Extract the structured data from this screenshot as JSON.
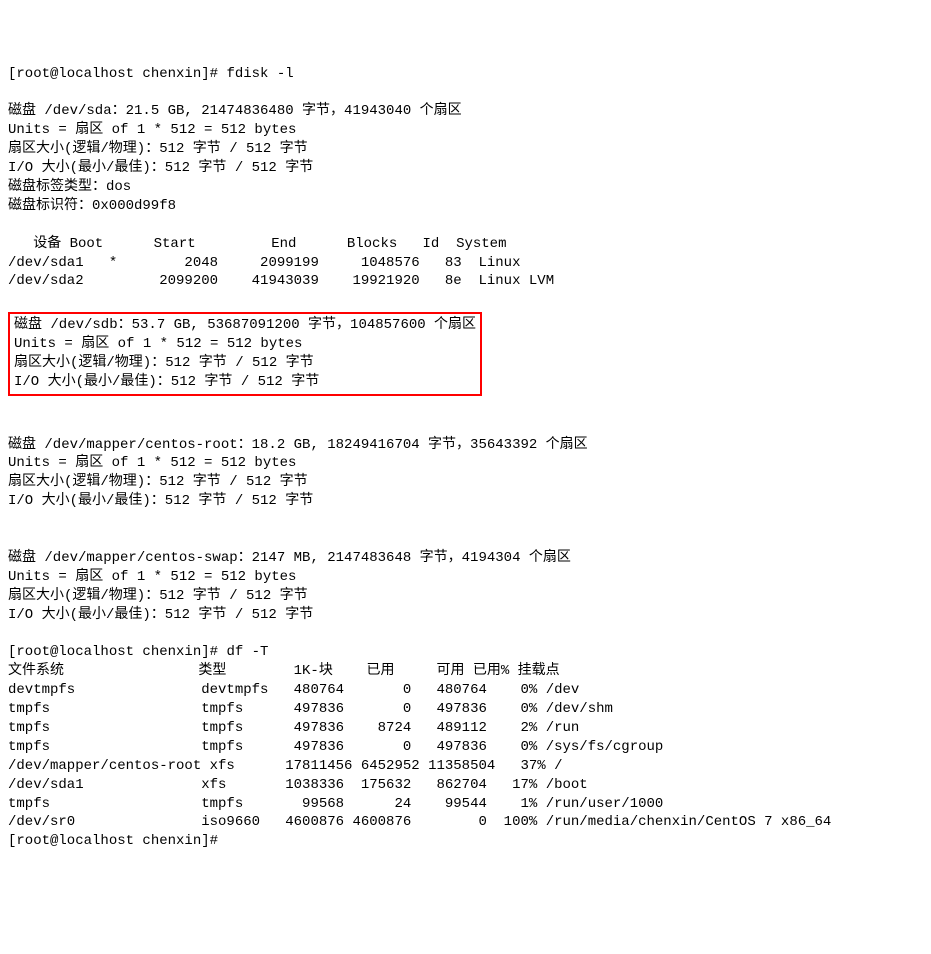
{
  "prompt": "[root@localhost chenxin]# ",
  "cmd_fdisk": "fdisk -l",
  "blank": "",
  "sda": {
    "l1": "磁盘 /dev/sda：21.5 GB, 21474836480 字节，41943040 个扇区",
    "l2": "Units = 扇区 of 1 * 512 = 512 bytes",
    "l3": "扇区大小(逻辑/物理)：512 字节 / 512 字节",
    "l4": "I/O 大小(最小/最佳)：512 字节 / 512 字节",
    "l5": "磁盘标签类型：dos",
    "l6": "磁盘标识符：0x000d99f8"
  },
  "parts": {
    "hdr": "   设备 Boot      Start         End      Blocks   Id  System",
    "r1": "/dev/sda1   *        2048     2099199     1048576   83  Linux",
    "r2": "/dev/sda2         2099200    41943039    19921920   8e  Linux LVM"
  },
  "sdb": {
    "l1": "磁盘 /dev/sdb：53.7 GB, 53687091200 字节，104857600 个扇区",
    "l2": "Units = 扇区 of 1 * 512 = 512 bytes",
    "l3": "扇区大小(逻辑/物理)：512 字节 / 512 字节",
    "l4": "I/O 大小(最小/最佳)：512 字节 / 512 字节"
  },
  "root": {
    "l1": "磁盘 /dev/mapper/centos-root：18.2 GB, 18249416704 字节，35643392 个扇区",
    "l2": "Units = 扇区 of 1 * 512 = 512 bytes",
    "l3": "扇区大小(逻辑/物理)：512 字节 / 512 字节",
    "l4": "I/O 大小(最小/最佳)：512 字节 / 512 字节"
  },
  "swap": {
    "l1": "磁盘 /dev/mapper/centos-swap：2147 MB, 2147483648 字节，4194304 个扇区",
    "l2": "Units = 扇区 of 1 * 512 = 512 bytes",
    "l3": "扇区大小(逻辑/物理)：512 字节 / 512 字节",
    "l4": "I/O 大小(最小/最佳)：512 字节 / 512 字节"
  },
  "cmd_df": "df -T",
  "df": {
    "hdr": "文件系统                类型        1K-块    已用     可用 已用% 挂载点",
    "r1": "devtmpfs               devtmpfs   480764       0   480764    0% /dev",
    "r2": "tmpfs                  tmpfs      497836       0   497836    0% /dev/shm",
    "r3": "tmpfs                  tmpfs      497836    8724   489112    2% /run",
    "r4": "tmpfs                  tmpfs      497836       0   497836    0% /sys/fs/cgroup",
    "r5": "/dev/mapper/centos-root xfs      17811456 6452952 11358504   37% /",
    "r6": "/dev/sda1              xfs       1038336  175632   862704   17% /boot",
    "r7": "tmpfs                  tmpfs       99568      24    99544    1% /run/user/1000",
    "r8": "/dev/sr0               iso9660   4600876 4600876        0  100% /run/media/chenxin/CentOS 7 x86_64"
  }
}
